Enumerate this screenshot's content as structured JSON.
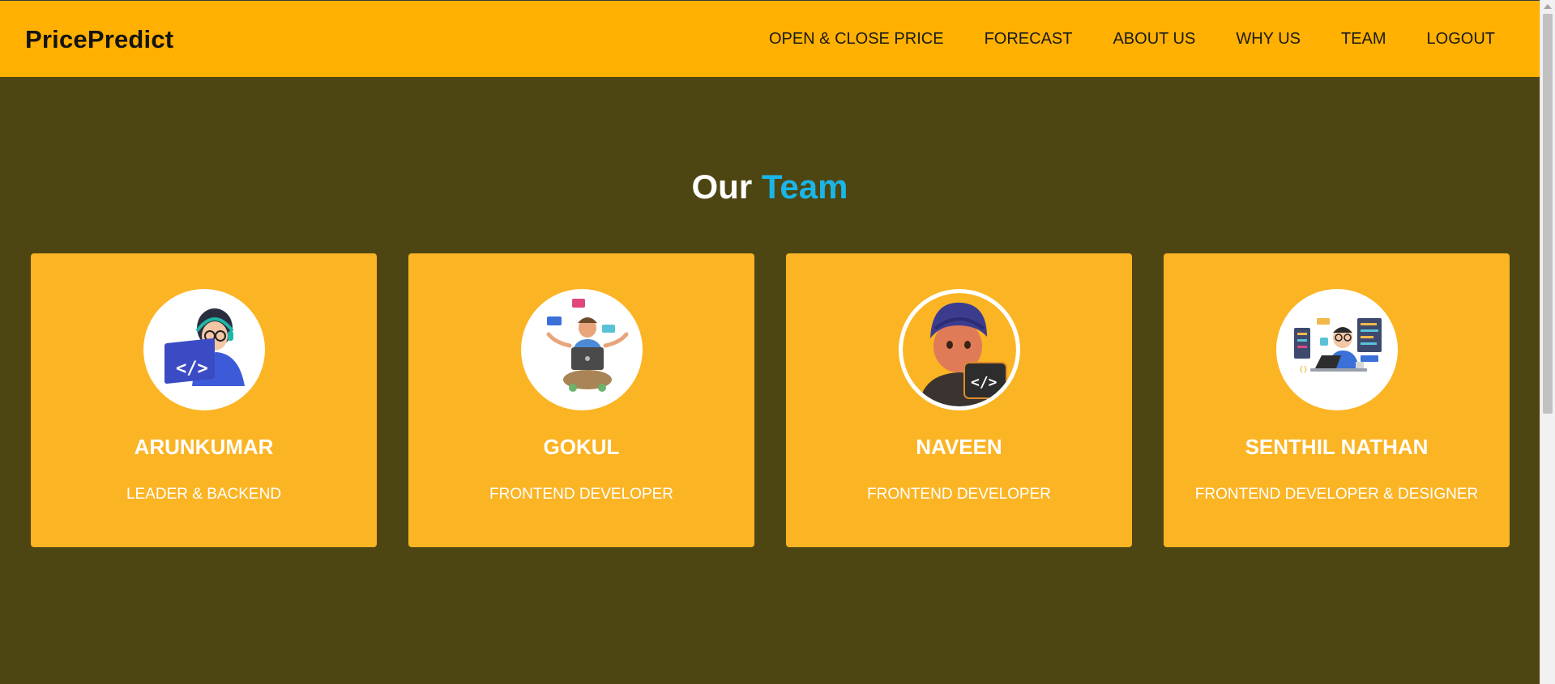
{
  "navbar": {
    "brand": "PricePredict",
    "links": [
      {
        "label": "OPEN & CLOSE PRICE"
      },
      {
        "label": "FORECAST"
      },
      {
        "label": "ABOUT US"
      },
      {
        "label": "WHY US"
      },
      {
        "label": "TEAM"
      },
      {
        "label": "LOGOUT"
      }
    ]
  },
  "team": {
    "title_part1": "Our",
    "title_part2": "Team",
    "members": [
      {
        "name": "ARUNKUMAR",
        "role": "LEADER & BACKEND",
        "avatar_icon": "developer-laptop-avatar-icon"
      },
      {
        "name": "GOKUL",
        "role": "FRONTEND DEVELOPER",
        "avatar_icon": "developer-meditating-avatar-icon"
      },
      {
        "name": "NAVEEN",
        "role": "FRONTEND DEVELOPER",
        "avatar_icon": "developer-turban-avatar-icon"
      },
      {
        "name": "SENTHIL NATHAN",
        "role": "FRONTEND DEVELOPER & DESIGNER",
        "avatar_icon": "developer-desk-avatar-icon"
      }
    ]
  },
  "colors": {
    "navbar_bg": "#ffb000",
    "page_bg": "#4e4612",
    "card_bg": "#fbb424",
    "title_accent": "#1ab6e8"
  }
}
